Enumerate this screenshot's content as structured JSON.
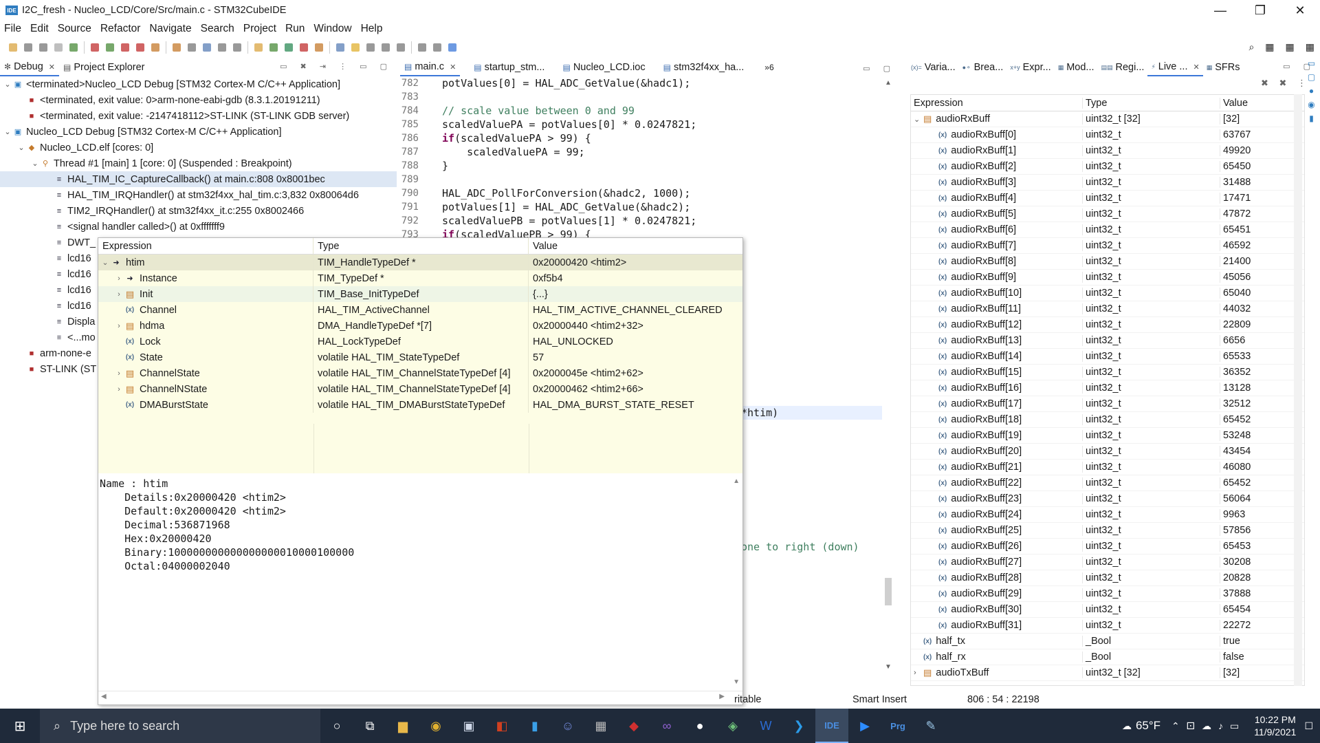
{
  "window": {
    "title": "I2C_fresh - Nucleo_LCD/Core/Src/main.c - STM32CubeIDE",
    "app_icon": "IDE"
  },
  "menu": [
    "File",
    "Edit",
    "Source",
    "Refactor",
    "Navigate",
    "Search",
    "Project",
    "Run",
    "Window",
    "Help"
  ],
  "debug_view": {
    "tabs": [
      {
        "label": "Debug"
      },
      {
        "label": "Project Explorer"
      }
    ],
    "tree": [
      {
        "indent": 0,
        "twisty": "v",
        "icon": "app",
        "text": "<terminated>Nucleo_LCD Debug [STM32 Cortex-M C/C++ Application]"
      },
      {
        "indent": 1,
        "twisty": "",
        "icon": "proc",
        "text": "<terminated, exit value: 0>arm-none-eabi-gdb (8.3.1.20191211)"
      },
      {
        "indent": 1,
        "twisty": "",
        "icon": "proc",
        "text": "<terminated, exit value: -2147418112>ST-LINK (ST-LINK GDB server)"
      },
      {
        "indent": 0,
        "twisty": "v",
        "icon": "app",
        "text": "Nucleo_LCD Debug [STM32 Cortex-M C/C++ Application]"
      },
      {
        "indent": 1,
        "twisty": "v",
        "icon": "elf",
        "text": "Nucleo_LCD.elf [cores: 0]"
      },
      {
        "indent": 2,
        "twisty": "v",
        "icon": "thread",
        "text": "Thread #1 [main] 1 [core: 0] (Suspended : Breakpoint)"
      },
      {
        "indent": 3,
        "twisty": "",
        "icon": "frame",
        "text": "HAL_TIM_IC_CaptureCallback() at main.c:808 0x8001bec",
        "selected": true
      },
      {
        "indent": 3,
        "twisty": "",
        "icon": "frame",
        "text": "HAL_TIM_IRQHandler() at stm32f4xx_hal_tim.c:3,832 0x80064d6"
      },
      {
        "indent": 3,
        "twisty": "",
        "icon": "frame",
        "text": "TIM2_IRQHandler() at stm32f4xx_it.c:255 0x8002466"
      },
      {
        "indent": 3,
        "twisty": "",
        "icon": "frame",
        "text": "<signal handler called>() at 0xfffffff9"
      },
      {
        "indent": 3,
        "twisty": "",
        "icon": "frame",
        "text": "DWT_"
      },
      {
        "indent": 3,
        "twisty": "",
        "icon": "frame",
        "text": "lcd16"
      },
      {
        "indent": 3,
        "twisty": "",
        "icon": "frame",
        "text": "lcd16"
      },
      {
        "indent": 3,
        "twisty": "",
        "icon": "frame",
        "text": "lcd16"
      },
      {
        "indent": 3,
        "twisty": "",
        "icon": "frame",
        "text": "lcd16"
      },
      {
        "indent": 3,
        "twisty": "",
        "icon": "frame",
        "text": "Displa"
      },
      {
        "indent": 3,
        "twisty": "",
        "icon": "frame",
        "text": "<...mo"
      },
      {
        "indent": 1,
        "twisty": "",
        "icon": "proc",
        "text": "arm-none-e"
      },
      {
        "indent": 1,
        "twisty": "",
        "icon": "proc",
        "text": "ST-LINK (ST"
      }
    ]
  },
  "editor": {
    "tabs": [
      {
        "label": "main.c",
        "active": true
      },
      {
        "label": "startup_stm..."
      },
      {
        "label": "Nucleo_LCD.ioc"
      },
      {
        "label": "stm32f4xx_ha..."
      }
    ],
    "overflow": "»6",
    "lines": [
      {
        "n": "782",
        "code": "potValues[0] = HAL_ADC_GetValue(&hadc1);"
      },
      {
        "n": "783",
        "code": ""
      },
      {
        "n": "784",
        "code": "// scale value between 0 and 99",
        "type": "comment"
      },
      {
        "n": "785",
        "code": "scaledValuePA = potValues[0] * 0.0247821;"
      },
      {
        "n": "786",
        "kw": "if",
        "code": "(scaledValuePA > 99) {"
      },
      {
        "n": "787",
        "code": "    scaledValuePA = 99;"
      },
      {
        "n": "788",
        "code": "}"
      },
      {
        "n": "789",
        "code": ""
      },
      {
        "n": "790",
        "code": "HAL_ADC_PollForConversion(&hadc2, 1000);"
      },
      {
        "n": "791",
        "code": "potValues[1] = HAL_ADC_GetValue(&hadc2);"
      },
      {
        "n": "792",
        "code": "scaledValuePB = potValues[1] * 0.0247821;"
      },
      {
        "n": "793",
        "kw": "if",
        "code": "(scaledValuePB > 99) {"
      }
    ],
    "fragment_a": "*htim)",
    "fragment_b": "one to right (down)"
  },
  "hover": {
    "columns": [
      "Expression",
      "Type",
      "Value"
    ],
    "rows": [
      {
        "lvl": 0,
        "tw": "v",
        "icon": "ptr",
        "name": "htim",
        "type": "TIM_HandleTypeDef *",
        "value": "0x20000420 <htim2>",
        "sel": true
      },
      {
        "lvl": 1,
        "tw": ">",
        "icon": "ptr",
        "name": "Instance",
        "type": "TIM_TypeDef *",
        "value": "0xf5b4"
      },
      {
        "lvl": 1,
        "tw": ">",
        "icon": "struct",
        "name": "Init",
        "type": "TIM_Base_InitTypeDef",
        "value": "{...}",
        "alt": true
      },
      {
        "lvl": 1,
        "tw": "",
        "icon": "var",
        "name": "Channel",
        "type": "HAL_TIM_ActiveChannel",
        "value": "HAL_TIM_ACTIVE_CHANNEL_CLEARED"
      },
      {
        "lvl": 1,
        "tw": ">",
        "icon": "struct",
        "name": "hdma",
        "type": "DMA_HandleTypeDef *[7]",
        "value": "0x20000440 <htim2+32>"
      },
      {
        "lvl": 1,
        "tw": "",
        "icon": "var",
        "name": "Lock",
        "type": "HAL_LockTypeDef",
        "value": "HAL_UNLOCKED"
      },
      {
        "lvl": 1,
        "tw": "",
        "icon": "var",
        "name": "State",
        "type": "volatile HAL_TIM_StateTypeDef",
        "value": "57"
      },
      {
        "lvl": 1,
        "tw": ">",
        "icon": "struct",
        "name": "ChannelState",
        "type": "volatile HAL_TIM_ChannelStateTypeDef [4]",
        "value": "0x2000045e <htim2+62>"
      },
      {
        "lvl": 1,
        "tw": ">",
        "icon": "struct",
        "name": "ChannelNState",
        "type": "volatile HAL_TIM_ChannelStateTypeDef [4]",
        "value": "0x20000462 <htim2+66>"
      },
      {
        "lvl": 1,
        "tw": "",
        "icon": "var",
        "name": "DMABurstState",
        "type": "volatile HAL_TIM_DMABurstStateTypeDef",
        "value": "HAL_DMA_BURST_STATE_RESET"
      }
    ],
    "detail": "Name : htim\n    Details:0x20000420 <htim2>\n    Default:0x20000420 <htim2>\n    Decimal:536871968\n    Hex:0x20000420\n    Binary:100000000000000000010000100000\n    Octal:04000002040"
  },
  "expressions_view": {
    "tabs": [
      "Varia...",
      "Brea...",
      "Expr...",
      "Mod...",
      "Regi...",
      "Live ...",
      "SFRs"
    ],
    "columns": [
      "Expression",
      "Type",
      "Value"
    ],
    "rows": [
      {
        "lvl": 0,
        "tw": "v",
        "name": "audioRxBuff",
        "type": "uint32_t [32]",
        "value": "[32]",
        "struct": true
      },
      {
        "lvl": 1,
        "name": "audioRxBuff[0]",
        "type": "uint32_t",
        "value": "63767"
      },
      {
        "lvl": 1,
        "name": "audioRxBuff[1]",
        "type": "uint32_t",
        "value": "49920"
      },
      {
        "lvl": 1,
        "name": "audioRxBuff[2]",
        "type": "uint32_t",
        "value": "65450"
      },
      {
        "lvl": 1,
        "name": "audioRxBuff[3]",
        "type": "uint32_t",
        "value": "31488"
      },
      {
        "lvl": 1,
        "name": "audioRxBuff[4]",
        "type": "uint32_t",
        "value": "17471"
      },
      {
        "lvl": 1,
        "name": "audioRxBuff[5]",
        "type": "uint32_t",
        "value": "47872"
      },
      {
        "lvl": 1,
        "name": "audioRxBuff[6]",
        "type": "uint32_t",
        "value": "65451"
      },
      {
        "lvl": 1,
        "name": "audioRxBuff[7]",
        "type": "uint32_t",
        "value": "46592"
      },
      {
        "lvl": 1,
        "name": "audioRxBuff[8]",
        "type": "uint32_t",
        "value": "21400"
      },
      {
        "lvl": 1,
        "name": "audioRxBuff[9]",
        "type": "uint32_t",
        "value": "45056"
      },
      {
        "lvl": 1,
        "name": "audioRxBuff[10]",
        "type": "uint32_t",
        "value": "65040"
      },
      {
        "lvl": 1,
        "name": "audioRxBuff[11]",
        "type": "uint32_t",
        "value": "44032"
      },
      {
        "lvl": 1,
        "name": "audioRxBuff[12]",
        "type": "uint32_t",
        "value": "22809"
      },
      {
        "lvl": 1,
        "name": "audioRxBuff[13]",
        "type": "uint32_t",
        "value": "6656"
      },
      {
        "lvl": 1,
        "name": "audioRxBuff[14]",
        "type": "uint32_t",
        "value": "65533"
      },
      {
        "lvl": 1,
        "name": "audioRxBuff[15]",
        "type": "uint32_t",
        "value": "36352"
      },
      {
        "lvl": 1,
        "name": "audioRxBuff[16]",
        "type": "uint32_t",
        "value": "13128"
      },
      {
        "lvl": 1,
        "name": "audioRxBuff[17]",
        "type": "uint32_t",
        "value": "32512"
      },
      {
        "lvl": 1,
        "name": "audioRxBuff[18]",
        "type": "uint32_t",
        "value": "65452"
      },
      {
        "lvl": 1,
        "name": "audioRxBuff[19]",
        "type": "uint32_t",
        "value": "53248"
      },
      {
        "lvl": 1,
        "name": "audioRxBuff[20]",
        "type": "uint32_t",
        "value": "43454"
      },
      {
        "lvl": 1,
        "name": "audioRxBuff[21]",
        "type": "uint32_t",
        "value": "46080"
      },
      {
        "lvl": 1,
        "name": "audioRxBuff[22]",
        "type": "uint32_t",
        "value": "65452"
      },
      {
        "lvl": 1,
        "name": "audioRxBuff[23]",
        "type": "uint32_t",
        "value": "56064"
      },
      {
        "lvl": 1,
        "name": "audioRxBuff[24]",
        "type": "uint32_t",
        "value": "9963"
      },
      {
        "lvl": 1,
        "name": "audioRxBuff[25]",
        "type": "uint32_t",
        "value": "57856"
      },
      {
        "lvl": 1,
        "name": "audioRxBuff[26]",
        "type": "uint32_t",
        "value": "65453"
      },
      {
        "lvl": 1,
        "name": "audioRxBuff[27]",
        "type": "uint32_t",
        "value": "30208"
      },
      {
        "lvl": 1,
        "name": "audioRxBuff[28]",
        "type": "uint32_t",
        "value": "20828"
      },
      {
        "lvl": 1,
        "name": "audioRxBuff[29]",
        "type": "uint32_t",
        "value": "37888"
      },
      {
        "lvl": 1,
        "name": "audioRxBuff[30]",
        "type": "uint32_t",
        "value": "65454"
      },
      {
        "lvl": 1,
        "name": "audioRxBuff[31]",
        "type": "uint32_t",
        "value": "22272"
      },
      {
        "lvl": 0,
        "name": "half_tx",
        "type": "_Bool",
        "value": "true"
      },
      {
        "lvl": 0,
        "name": "half_rx",
        "type": "_Bool",
        "value": "false"
      },
      {
        "lvl": 0,
        "tw": ">",
        "name": "audioTxBuff",
        "type": "uint32_t [32]",
        "value": "[32]",
        "struct": true
      }
    ]
  },
  "statusbar": {
    "writable": "ritable",
    "insert_mode": "Smart Insert",
    "position": "806 : 54 : 22198"
  },
  "taskbar": {
    "search_placeholder": "Type here to search",
    "weather": "65°F",
    "time": "10:22 PM",
    "date": "11/9/2021",
    "apps": [
      "task-view",
      "taskview2",
      "file-explorer",
      "chrome",
      "store",
      "office",
      "files",
      "discord",
      "calculator",
      "cube",
      "visual-studio",
      "github",
      "git",
      "word",
      "vscode",
      "stm32cubeide",
      "zoom",
      "prg",
      "notepad"
    ]
  }
}
